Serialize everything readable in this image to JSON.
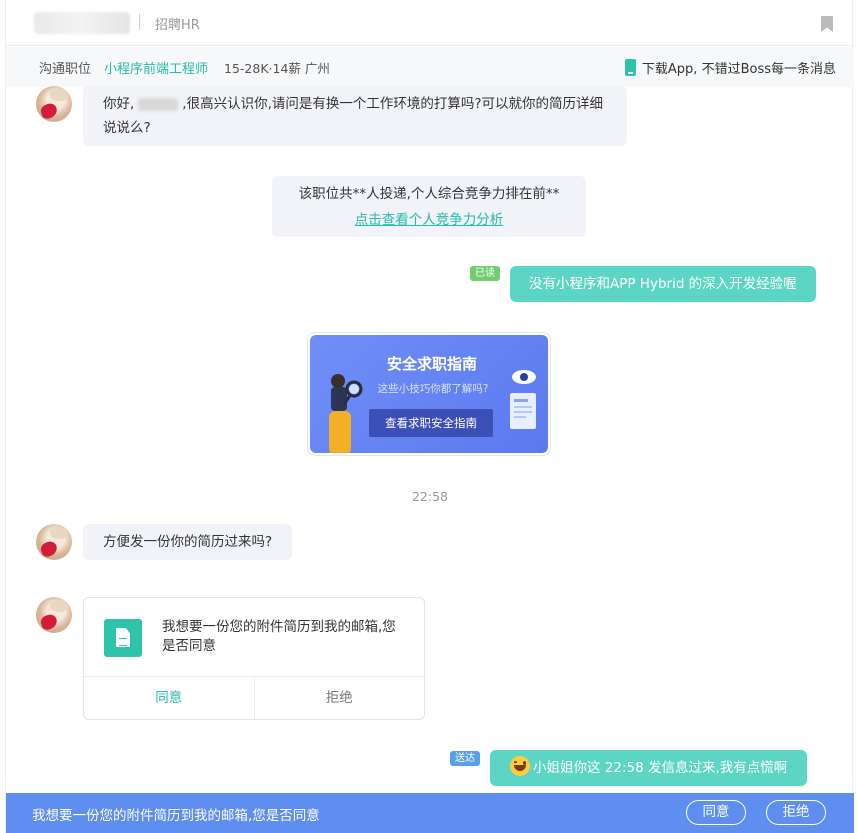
{
  "header": {
    "hr_role": "招聘HR",
    "bookmark_icon": "bookmark-icon"
  },
  "position_bar": {
    "label": "沟通职位",
    "job_title": "小程序前端工程师",
    "salary_location": "15-28K·14薪 广州",
    "download_text": "下载App, 不错过Boss每一条消息"
  },
  "messages": {
    "greeting_prefix": "你好,",
    "greeting_rest": ",很高兴认识你,请问是有换一个工作环境的打算吗?可以就你的简历详细说说么?",
    "system_line1": "该职位共**人投递,个人综合竞争力排在前**",
    "system_link": "点击查看个人竞争力分析",
    "read_tag": "已读",
    "my_reply": "没有小程序和APP Hybrid 的深入开发经验喔",
    "safety_title": "安全求职指南",
    "safety_sub": "这些小技巧你都了解吗?",
    "safety_button": "查看求职安全指南",
    "timestamp": "22:58",
    "resume_ask": "方便发一份你的简历过来吗?",
    "resume_request_text": "我想要一份您的附件简历到我的邮箱,您是否同意",
    "agree_label": "同意",
    "refuse_label": "拒绝",
    "sent_tag": "送达",
    "my_reply2": "小姐姐你这 22:58 发信息过来,我有点慌啊"
  },
  "bottom_bar": {
    "message": "我想要一份您的附件简历到我的邮箱,您是否同意",
    "agree_label": "同意",
    "refuse_label": "拒绝"
  },
  "colors": {
    "accent": "#27bbaa",
    "outgoing_bubble": "#5dd5c4",
    "bottom_bar": "#5d8ef0",
    "read_tag": "#6fcf6f",
    "sent_tag": "#5aa0e8"
  }
}
